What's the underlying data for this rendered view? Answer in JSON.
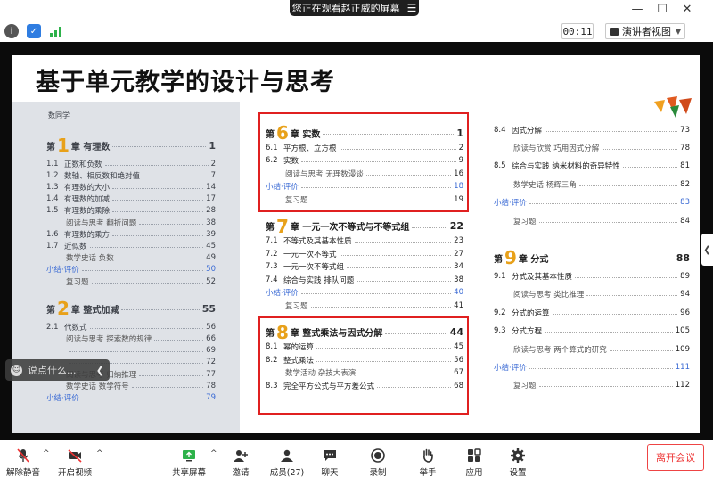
{
  "banner": {
    "text": "您正在观看赵正威的屏幕"
  },
  "toolbar_top": {
    "timer": "00:11",
    "view_label": "演讲者视图"
  },
  "slide": {
    "title": "基于单元教学的设计与思考",
    "photo_header": "数同学",
    "left_toc": [
      {
        "kind": "ch",
        "pre": "第",
        "num": "1",
        "post": "章  有理数",
        "page": "1"
      },
      {
        "n": "1.1",
        "t": "正数和负数",
        "page": "2"
      },
      {
        "n": "1.2",
        "t": "数轴、相反数和绝对值",
        "page": "7"
      },
      {
        "n": "1.3",
        "t": "有理数的大小",
        "page": "14"
      },
      {
        "n": "1.4",
        "t": "有理数的加减",
        "page": "17"
      },
      {
        "n": "1.5",
        "t": "有理数的乘除",
        "page": "28"
      },
      {
        "kind": "sub",
        "t": "阅读与思考  翻折问题",
        "page": "38"
      },
      {
        "n": "1.6",
        "t": "有理数的乘方",
        "page": "39"
      },
      {
        "n": "1.7",
        "t": "近似数",
        "page": "45"
      },
      {
        "kind": "sub",
        "t": "数学史话  负数",
        "page": "49"
      },
      {
        "kind": "blue",
        "t": "小结·评价",
        "page": "50"
      },
      {
        "kind": "sub",
        "t": "复习题",
        "page": "52"
      },
      {
        "kind": "gap"
      },
      {
        "kind": "ch",
        "pre": "第",
        "num": "2",
        "post": "章  整式加减",
        "page": "55"
      },
      {
        "n": "2.1",
        "t": "代数式",
        "page": "56"
      },
      {
        "kind": "sub",
        "t": "阅读与思考  探索数的规律",
        "page": "66"
      },
      {
        "kind": "sub",
        "t": "",
        "page": "69"
      },
      {
        "kind": "sub",
        "t": "",
        "page": "72"
      },
      {
        "kind": "sub",
        "t": "阅读与思考  归纳推理",
        "page": "77"
      },
      {
        "kind": "sub",
        "t": "数学史话  数学符号",
        "page": "78"
      },
      {
        "kind": "blue",
        "t": "小结·评价",
        "page": "79"
      }
    ],
    "mid_toc": [
      {
        "kind": "ch",
        "pre": "第",
        "num": "6",
        "post": "章   实数",
        "page": "1"
      },
      {
        "n": "6.1",
        "t": "平方根、立方根",
        "page": "2"
      },
      {
        "n": "6.2",
        "t": "实数",
        "page": "9"
      },
      {
        "kind": "sub",
        "t": "阅读与思考  无理数漫谈",
        "page": "16"
      },
      {
        "kind": "blue",
        "t": "小结·评价",
        "page": "18"
      },
      {
        "kind": "sub",
        "t": "复习题",
        "page": "19"
      },
      {
        "kind": "gap"
      },
      {
        "kind": "ch",
        "pre": "第",
        "num": "7",
        "post": "章   一元一次不等式与不等式组",
        "page": "22"
      },
      {
        "n": "7.1",
        "t": "不等式及其基本性质",
        "page": "23"
      },
      {
        "n": "7.2",
        "t": "一元一次不等式",
        "page": "27"
      },
      {
        "n": "7.3",
        "t": "一元一次不等式组",
        "page": "34"
      },
      {
        "n": "7.4",
        "t": "综合与实践  排队问题",
        "page": "38"
      },
      {
        "kind": "blue",
        "t": "小结·评价",
        "page": "40"
      },
      {
        "kind": "sub",
        "t": "复习题",
        "page": "41"
      },
      {
        "kind": "gap"
      },
      {
        "kind": "ch",
        "pre": "第",
        "num": "8",
        "post": "章   整式乘法与因式分解",
        "page": "44"
      },
      {
        "n": "8.1",
        "t": "幂的运算",
        "page": "45"
      },
      {
        "n": "8.2",
        "t": "整式乘法",
        "page": "56"
      },
      {
        "kind": "sub",
        "t": "数学活动  杂技大表演",
        "page": "67"
      },
      {
        "n": "8.3",
        "t": "完全平方公式与平方差公式",
        "page": "68"
      }
    ],
    "right_toc": [
      {
        "n": "8.4",
        "t": "因式分解",
        "page": "73"
      },
      {
        "kind": "sub",
        "t": "欣读与欣赏  巧用因式分解",
        "page": "78"
      },
      {
        "n": "8.5",
        "t": "综合与实践  纳米材料的奇异特性",
        "page": "81"
      },
      {
        "kind": "sub",
        "t": "数学史话  杨辉三角",
        "page": "82"
      },
      {
        "kind": "blue",
        "t": "小结·评价",
        "page": "83"
      },
      {
        "kind": "sub",
        "t": "复习题",
        "page": "84"
      },
      {
        "kind": "gap"
      },
      {
        "kind": "ch",
        "pre": "第",
        "num": "9",
        "post": "章   分式",
        "page": "88"
      },
      {
        "n": "9.1",
        "t": "分式及其基本性质",
        "page": "89"
      },
      {
        "kind": "sub",
        "t": "阅读与思考  类比推理",
        "page": "94"
      },
      {
        "n": "9.2",
        "t": "分式的运算",
        "page": "96"
      },
      {
        "n": "9.3",
        "t": "分式方程",
        "page": "105"
      },
      {
        "kind": "sub",
        "t": "欣读与思考  两个算式的研究",
        "page": "109"
      },
      {
        "kind": "blue",
        "t": "小结·评价",
        "page": "111"
      },
      {
        "kind": "sub",
        "t": "复习题",
        "page": "112"
      }
    ]
  },
  "chat": {
    "placeholder": "说点什么..."
  },
  "bottom": {
    "unmute": "解除静音",
    "video": "开启视频",
    "share": "共享屏幕",
    "invite": "邀请",
    "members": "成员(27)",
    "chat": "聊天",
    "record": "录制",
    "raise": "举手",
    "apps": "应用",
    "settings": "设置",
    "leave": "离开会议"
  },
  "colors": {
    "accent_red": "#e02020",
    "chapter_orange": "#e8a11a",
    "link_blue": "#3a6ad4"
  }
}
